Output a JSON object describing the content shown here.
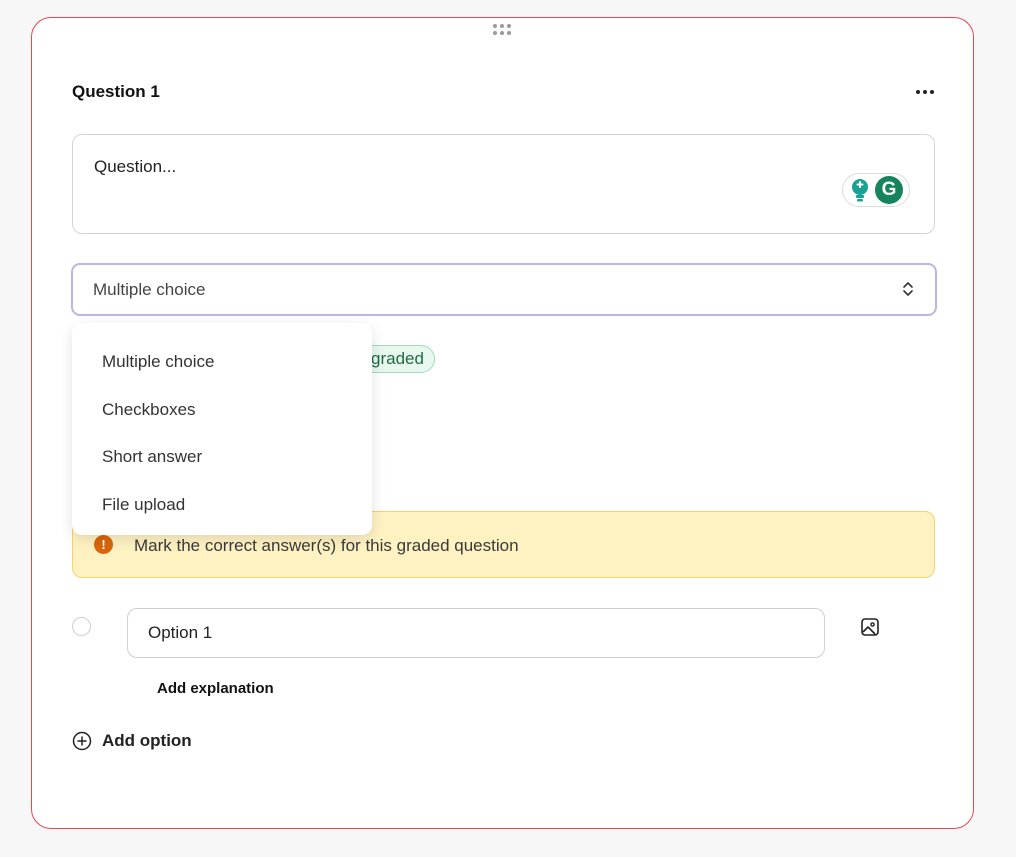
{
  "question": {
    "title": "Question 1",
    "placeholder": "Question..."
  },
  "type_select": {
    "value": "Multiple choice",
    "options": [
      "Multiple choice",
      "Checkboxes",
      "Short answer",
      "File upload"
    ]
  },
  "graded_badge": "graded",
  "warning": {
    "text": "Mark the correct answer(s) for this graded question"
  },
  "options": [
    {
      "value": "Option 1"
    }
  ],
  "labels": {
    "add_explanation": "Add explanation",
    "add_option": "Add option"
  },
  "icons": {
    "drag": "drag-handle-icon",
    "more": "more-horizontal-icon",
    "grammarly": "grammarly-icon",
    "bulb": "lightbulb-icon",
    "chevron": "chevron-up-down-icon",
    "warning": "exclamation-circle-icon",
    "image": "image-icon",
    "add": "plus-circle-icon"
  },
  "colors": {
    "card_border": "#e5484d",
    "select_focus": "#b6b8e8",
    "graded_bg": "#e8f8ef",
    "warning_bg": "#fef2c3",
    "warning_icon": "#d9660a",
    "grammarly": "#15835c"
  }
}
